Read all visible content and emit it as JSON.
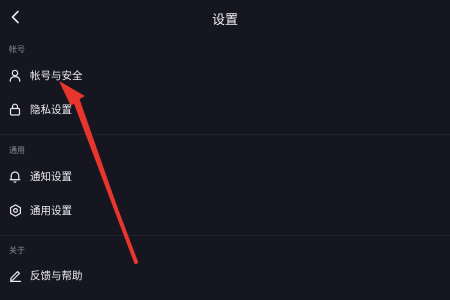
{
  "header": {
    "title": "设置",
    "back_icon": "chevron-left-icon"
  },
  "sections": [
    {
      "label": "帐号",
      "items": [
        {
          "label": "帐号与安全",
          "icon": "user-icon"
        },
        {
          "label": "隐私设置",
          "icon": "lock-icon"
        }
      ]
    },
    {
      "label": "通用",
      "items": [
        {
          "label": "通知设置",
          "icon": "bell-icon"
        },
        {
          "label": "通用设置",
          "icon": "gear-icon"
        }
      ]
    },
    {
      "label": "关于",
      "items": [
        {
          "label": "反馈与帮助",
          "icon": "edit-icon"
        }
      ]
    }
  ],
  "colors": {
    "background": "#15161f",
    "annotation_arrow": "#e8352d"
  }
}
